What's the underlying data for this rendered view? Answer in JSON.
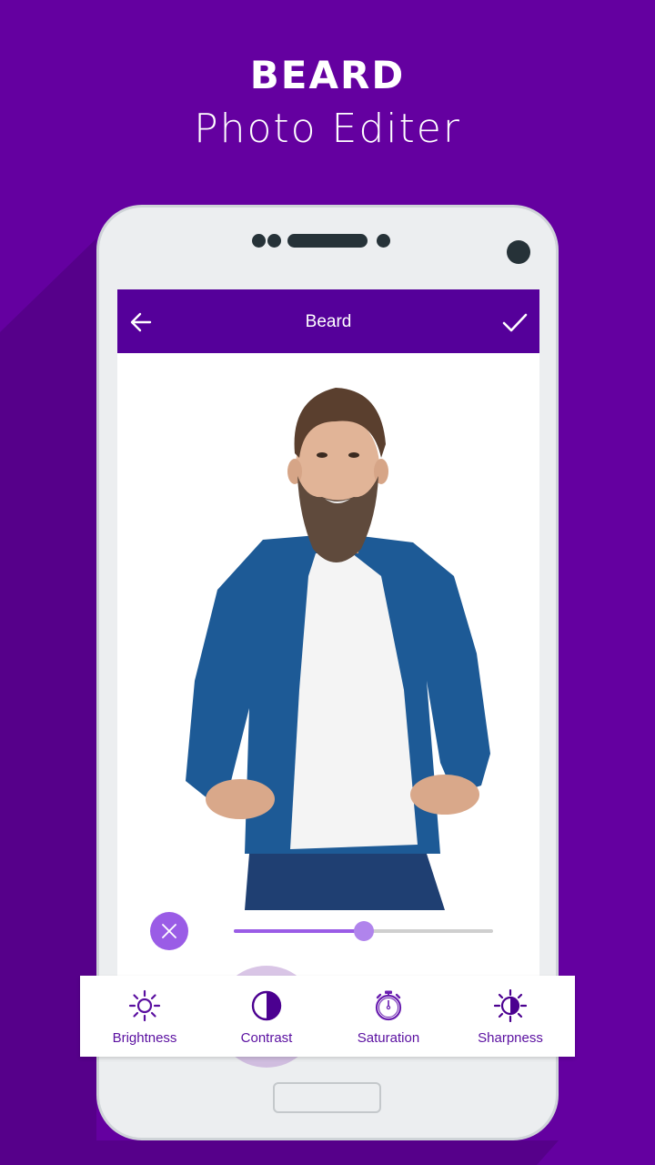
{
  "promo": {
    "title_line1": "BEARD",
    "title_line2": "Photo Editer"
  },
  "colors": {
    "background": "#6400a0",
    "appbar": "#55009a",
    "accent": "#9a5ce6",
    "tool_label": "#5a0fa0"
  },
  "app": {
    "header_title": "Beard",
    "back_icon": "arrow-left-icon",
    "confirm_icon": "check-icon"
  },
  "photo": {
    "subject": "bearded man in blue cardigan and white t-shirt"
  },
  "adjust": {
    "cancel_icon": "close-icon",
    "slider_value_percent": 50
  },
  "toolbar": {
    "selected": "Contrast",
    "tools": [
      {
        "label": "Brightness",
        "icon": "brightness-icon"
      },
      {
        "label": "Contrast",
        "icon": "contrast-icon"
      },
      {
        "label": "Saturation",
        "icon": "stopwatch-icon"
      },
      {
        "label": "Sharpness",
        "icon": "sharpness-icon"
      }
    ]
  }
}
